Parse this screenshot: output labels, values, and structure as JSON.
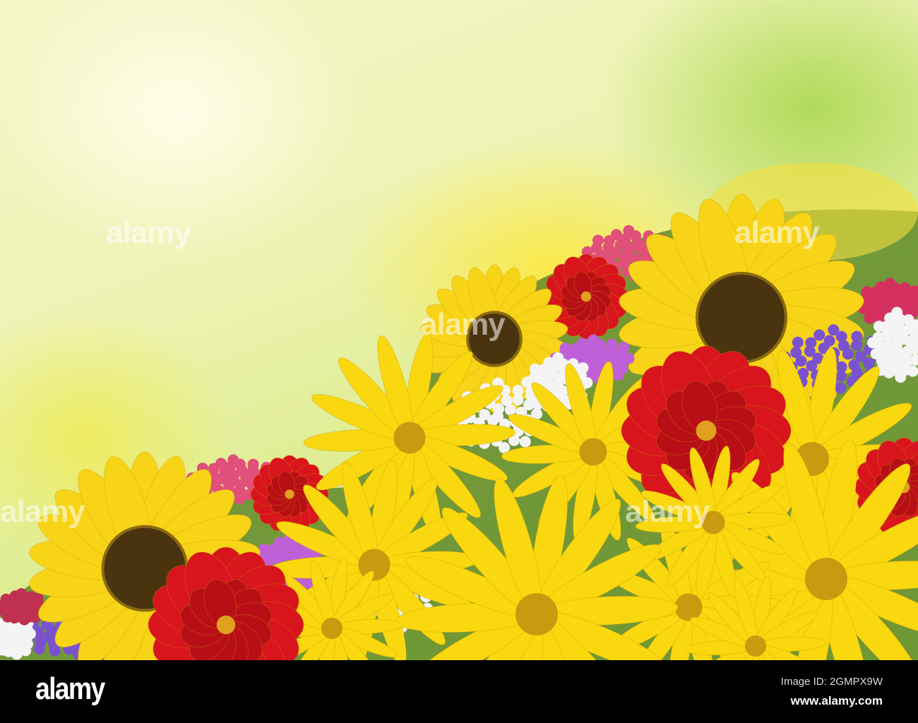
{
  "image": {
    "watermark": "alamy",
    "colors": {
      "sunflower": "#f7d417",
      "center": "#4a3410",
      "red": "#d8141c",
      "purple": "#7a52d0",
      "white": "#f4f4f4",
      "pink": "#e0507a"
    }
  },
  "footer": {
    "logo": "alamy",
    "image_id": "Image ID: 2GMPX9W",
    "website": "www.alamy.com"
  }
}
